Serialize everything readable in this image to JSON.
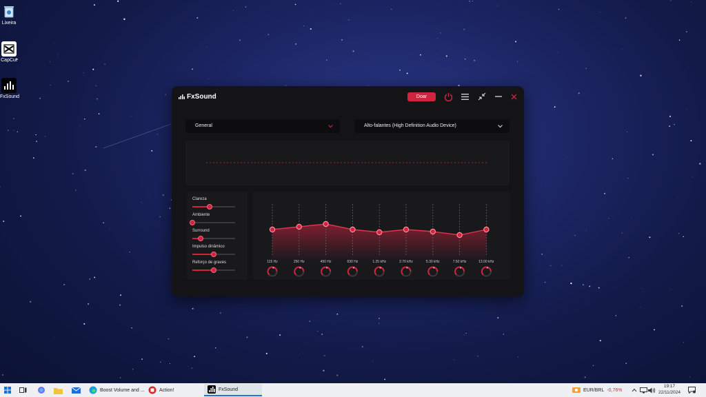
{
  "desktop": {
    "icons": [
      {
        "label": "Lixeira",
        "icon": "recycle-bin-icon"
      },
      {
        "label": "CapCut",
        "icon": "capcut-icon"
      },
      {
        "label": "FxSound",
        "icon": "fxsound-icon"
      }
    ]
  },
  "app": {
    "title": "FxSound",
    "donate_label": "Doar",
    "accent": "#d2233f",
    "preset": {
      "value": "General"
    },
    "device": {
      "value": "Alto-falantes (High Definition Audio Device)"
    },
    "effects": [
      {
        "label": "Clareza",
        "level": 0.4
      },
      {
        "label": "Ambiente",
        "level": 0.0
      },
      {
        "label": "Surround",
        "level": 0.2
      },
      {
        "label": "Impulso dinâmico",
        "level": 0.5
      },
      {
        "label": "Reforço de graves",
        "level": 0.5
      }
    ],
    "eq_bands": [
      {
        "freq": "115 Hz",
        "gain": 0.0
      },
      {
        "freq": "250 Hz",
        "gain": 0.4
      },
      {
        "freq": "450 Hz",
        "gain": 0.8
      },
      {
        "freq": "630 Hz",
        "gain": 0.0
      },
      {
        "freq": "1.25 kHz",
        "gain": -0.4
      },
      {
        "freq": "2.70 kHz",
        "gain": 0.0
      },
      {
        "freq": "5.30 kHz",
        "gain": -0.3
      },
      {
        "freq": "7.50 kHz",
        "gain": -0.8
      },
      {
        "freq": "13.00 kHz",
        "gain": 0.0
      }
    ]
  },
  "taskbar": {
    "apps": [
      {
        "label": "Boost Volume and ...",
        "icon": "edge-icon"
      },
      {
        "label": "Action!",
        "icon": "action-icon"
      },
      {
        "label": "FxSound",
        "icon": "fxsound-icon"
      }
    ],
    "ticker": {
      "symbol": "EUR/BRL",
      "change": "-0,76%"
    },
    "time": "19:17",
    "date": "22/11/2024"
  }
}
